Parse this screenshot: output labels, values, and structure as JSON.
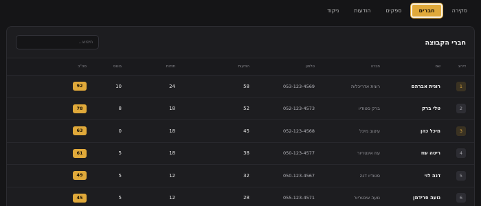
{
  "nav": {
    "tabs": [
      {
        "label": "סקירה",
        "active": false
      },
      {
        "label": "חברים",
        "active": true
      },
      {
        "label": "ספקים",
        "active": false
      },
      {
        "label": "הודעות",
        "active": false
      },
      {
        "label": "ניקוד",
        "active": false
      }
    ]
  },
  "panel": {
    "title": "חברי הקבוצה",
    "search_placeholder": "חיפוש...",
    "search_value": ""
  },
  "table": {
    "headers": {
      "rank": "דירוג",
      "name": "שם",
      "company": "חברה",
      "phone": "טלפון",
      "messages": "הודעות",
      "thanks": "תודות",
      "deals": "בונוס",
      "score": "סה\"כ"
    },
    "rows": [
      {
        "rank": "1",
        "name": "רונית אברהם",
        "company": "רונית אדריכלות",
        "phone": "053-123-4569",
        "messages": "58",
        "thanks": "24",
        "deals": "10",
        "score": "92",
        "top": true
      },
      {
        "rank": "2",
        "name": "טלי ברק",
        "company": "ברק סטודיו",
        "phone": "052-123-4573",
        "messages": "52",
        "thanks": "18",
        "deals": "8",
        "score": "78",
        "top": false
      },
      {
        "rank": "3",
        "name": "מיכל כהן",
        "company": "עיצוב מיכל",
        "phone": "052-123-4568",
        "messages": "45",
        "thanks": "18",
        "deals": "0",
        "score": "63",
        "top": true
      },
      {
        "rank": "4",
        "name": "ריטה עוז",
        "company": "עוז אינטריור",
        "phone": "050-123-4577",
        "messages": "38",
        "thanks": "18",
        "deals": "5",
        "score": "61",
        "top": false
      },
      {
        "rank": "5",
        "name": "דנה לוי",
        "company": "סטודיו דנה",
        "phone": "050-123-4567",
        "messages": "32",
        "thanks": "12",
        "deals": "5",
        "score": "49",
        "top": false
      },
      {
        "rank": "6",
        "name": "נועה פרידמן",
        "company": "נועה אינטריור",
        "phone": "055-123-4571",
        "messages": "28",
        "thanks": "12",
        "deals": "5",
        "score": "45",
        "top": false
      }
    ]
  },
  "colors": {
    "accent": "#e0a93a",
    "background": "#151517",
    "panel": "#1d1d20"
  }
}
